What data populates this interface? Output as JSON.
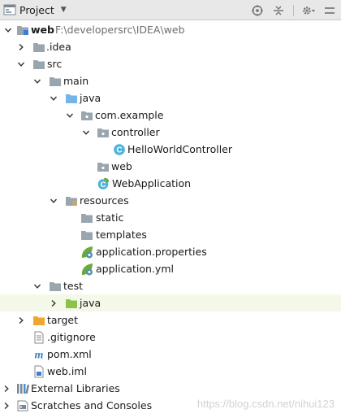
{
  "header": {
    "title": "Project",
    "dropdown_icon": "triangle-down-icon",
    "tools": [
      "locate-icon",
      "collapse-icon",
      "gear-icon",
      "hide-icon"
    ]
  },
  "tree": {
    "root": {
      "label": "web",
      "path": "F:\\developersrc\\IDEA\\web"
    },
    "idea": "idea",
    "src": "src",
    "main": "main",
    "java": "java",
    "com_example": "com.example",
    "controller": "controller",
    "hello_controller": "HelloWorldController",
    "web_pkg": "web",
    "web_app": "WebApplication",
    "resources": "resources",
    "static": "static",
    "templates": "templates",
    "app_properties": "application.properties",
    "app_yml": "application.yml",
    "test": "test",
    "test_java": "java",
    "target": "target",
    "gitignore": ".gitignore",
    "pom": "pom.xml",
    "webiml": "web.iml",
    "external_libraries": "External Libraries",
    "scratches": "Scratches and Consoles"
  },
  "colors": {
    "folder_gray": "#9aa6ae",
    "folder_blue": "#77b4e6",
    "folder_orange": "#f0a732",
    "folder_green": "#8bc34a",
    "class_cyan": "#4fb3d9",
    "spring_green": "#6aab3a",
    "highlight_row": "#f4f8e8"
  },
  "watermark": "https://blog.csdn.net/nihui123"
}
